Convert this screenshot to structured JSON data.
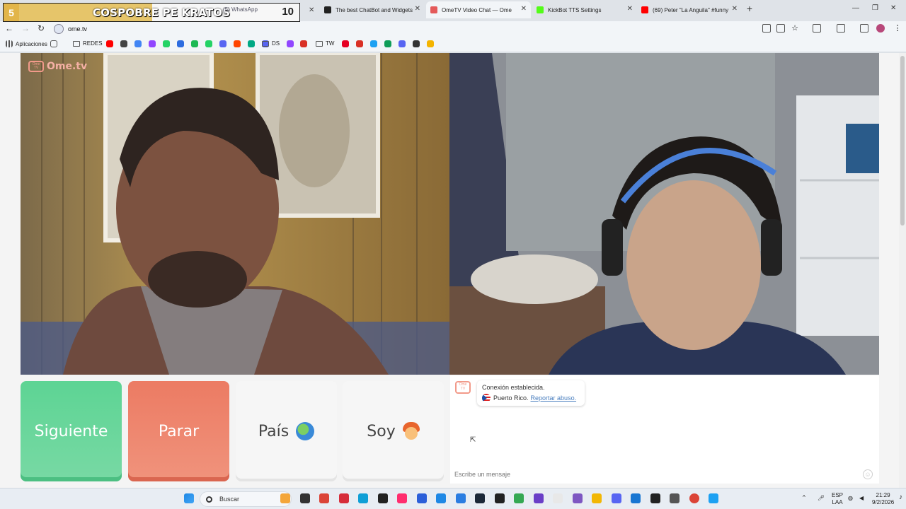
{
  "browser": {
    "tabs": [
      {
        "title": "(5) WhatsApp",
        "favicon_color": "#25d366"
      },
      {
        "title": "The best ChatBot and Widgets",
        "favicon_color": "#222222"
      },
      {
        "title": "OmeTV Video Chat — Ome",
        "favicon_color": "#e45a5a"
      },
      {
        "title": "KickBot TTS Settings",
        "favicon_color": "#53fc18"
      },
      {
        "title": "(69) Peter \"La Anguila\" #funny",
        "favicon_color": "#ff0000"
      }
    ],
    "overlay": {
      "left_number": "5",
      "title": "COSPOBRE PE KRATOS",
      "right_number": "10"
    },
    "url": "ome.tv",
    "bookmarks": [
      {
        "label": "Aplicaciones",
        "icon": "apps-grid-icon"
      },
      {
        "label": "REDES",
        "icon": "folder-icon"
      },
      {
        "label": "DS",
        "icon": "folder-icon"
      },
      {
        "label": "TW",
        "icon": "folder-icon"
      }
    ],
    "bookmark_icon_colors": [
      "#ff0000",
      "#444444",
      "#4285f4",
      "#9146ff",
      "#25d366",
      "#2d6cdf",
      "#1db954",
      "#25d366",
      "#5865f2",
      "#ff4500",
      "#00a884",
      "#5865f2",
      "#e60023",
      "#d93025",
      "#1da1f2",
      "#0f9d58",
      "#5865f2",
      "#333333",
      "#f4b400"
    ]
  },
  "omegle": {
    "logo_text": "Ome.tv",
    "logo_box_text": "Ome TV",
    "buttons": {
      "next": "Siguiente",
      "stop": "Parar",
      "country": "País",
      "iam": "Soy"
    },
    "chat": {
      "status": "Conexión establecida.",
      "country": "Puerto Rico.",
      "report_link": "Reportar abuso.",
      "input_placeholder": "Escribe un mensaje"
    }
  },
  "taskbar": {
    "search_label": "Buscar",
    "lang_top": "ESP",
    "lang_bottom": "LAA",
    "time": "21:29",
    "date": "9/2/2026",
    "icon_colors": [
      "#f4a63a",
      "#333333",
      "#db4437",
      "#d62d3a",
      "#0f9fd6",
      "#222222",
      "#ff2d6f",
      "#2b5fd9",
      "#1e88e5",
      "#2a7de1",
      "#1b2838",
      "#222222",
      "#35a853",
      "#6a3fc7",
      "#e8e8e8",
      "#7e57c2",
      "#f2b705",
      "#5865f2",
      "#1976d2",
      "#222222",
      "#555555",
      "#db4437",
      "#1da1f2"
    ]
  }
}
